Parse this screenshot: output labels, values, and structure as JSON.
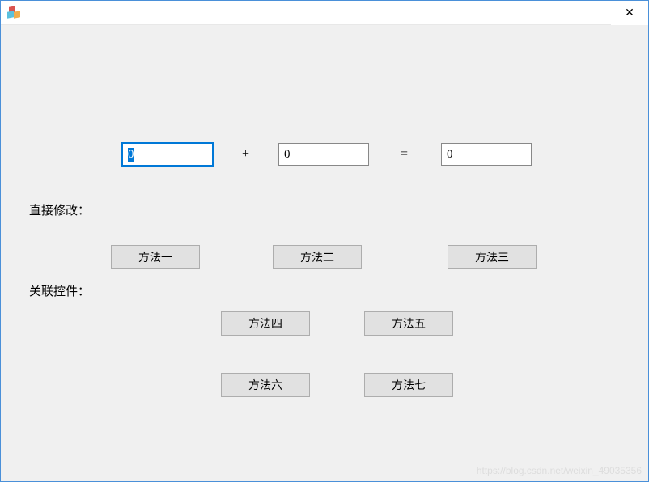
{
  "window": {
    "title": ""
  },
  "inputs": {
    "operand1": "0",
    "operand2": "0",
    "result": "0"
  },
  "ops": {
    "plus": "+",
    "equals": "="
  },
  "labels": {
    "direct_modify": "直接修改：",
    "linked_control": "关联控件："
  },
  "buttons": {
    "m1": "方法一",
    "m2": "方法二",
    "m3": "方法三",
    "m4": "方法四",
    "m5": "方法五",
    "m6": "方法六",
    "m7": "方法七"
  },
  "watermark": "https://blog.csdn.net/weixin_49035356"
}
